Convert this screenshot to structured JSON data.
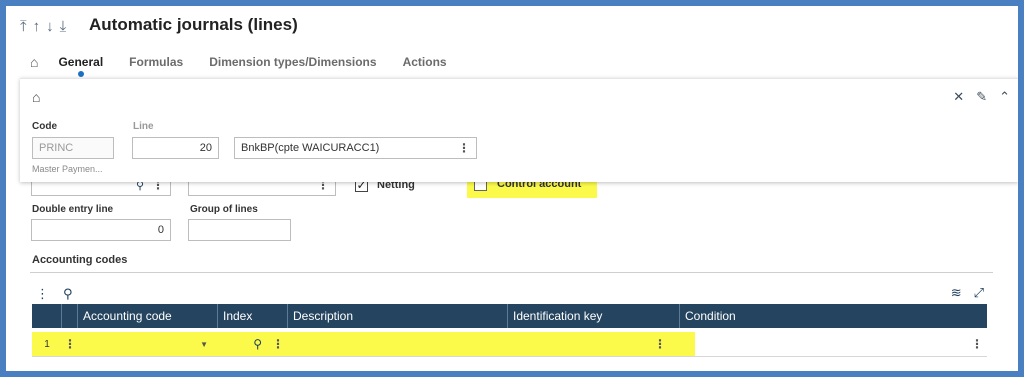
{
  "header": {
    "title": "Automatic journals (lines)",
    "nav_icons": [
      "first-record-icon",
      "previous-record-icon",
      "next-record-icon",
      "last-record-icon"
    ],
    "nav_glyphs": [
      "⤒",
      "↑",
      "↓",
      "⤓"
    ]
  },
  "tabs": [
    {
      "label": "General",
      "active": true
    },
    {
      "label": "Formulas",
      "active": false
    },
    {
      "label": "Dimension types/Dimensions",
      "active": false
    },
    {
      "label": "Actions",
      "active": false
    }
  ],
  "card": {
    "code_label": "Code",
    "code_value": "PRINC",
    "code_description": "Master Paymen...",
    "line_label": "Line",
    "line_value": "20",
    "name_value": "BnkBP(cpte WAICURACC1)"
  },
  "body": {
    "netting_label": "Netting",
    "netting_checked": true,
    "control_account_label": "Control account",
    "control_account_checked": false,
    "double_entry_label": "Double entry line",
    "double_entry_value": "0",
    "group_label": "Group of lines",
    "group_value": ""
  },
  "accounting_codes": {
    "title": "Accounting codes",
    "columns": [
      "Accounting code",
      "Index",
      "Description",
      "Identification key",
      "Condition"
    ],
    "rows": [
      {
        "num": "1",
        "accounting_code": "",
        "index": "",
        "description": "",
        "identification_key": "",
        "condition": ""
      }
    ]
  },
  "colors": {
    "frame_border": "#4a7fc1",
    "grid_header": "#25445f",
    "highlight": "#fbfa4b",
    "active_tab_dot": "#1e6fc4"
  }
}
